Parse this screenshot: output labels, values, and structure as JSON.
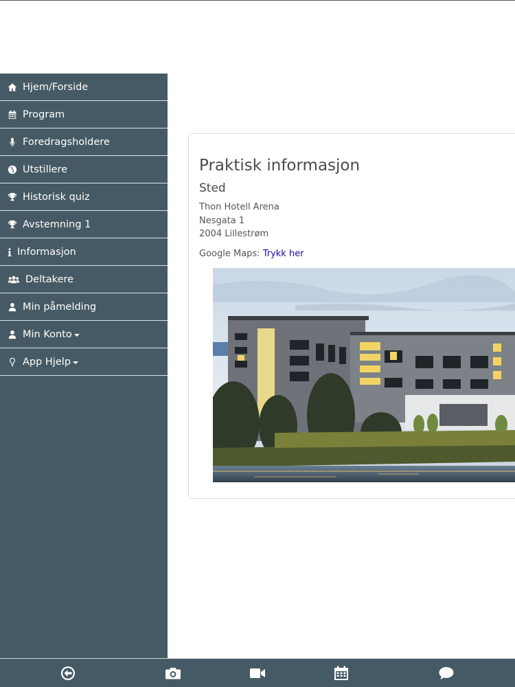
{
  "sidebar": {
    "items": [
      {
        "label": "Hjem/Forside",
        "icon": "home-icon"
      },
      {
        "label": "Program",
        "icon": "calendar-icon"
      },
      {
        "label": "Foredragsholdere",
        "icon": "microphone-icon"
      },
      {
        "label": "Utstillere",
        "icon": "globe-icon"
      },
      {
        "label": "Historisk quiz",
        "icon": "trophy-icon"
      },
      {
        "label": "Avstemning 1",
        "icon": "trophy-icon"
      },
      {
        "label": "Informasjon",
        "icon": "info-icon"
      },
      {
        "label": "Deltakere",
        "icon": "users-icon"
      },
      {
        "label": "Min påmelding",
        "icon": "user-icon"
      },
      {
        "label": "Min Konto",
        "icon": "user-icon",
        "dropdown": true
      },
      {
        "label": "App Hjelp",
        "icon": "lightbulb-icon",
        "dropdown": true
      }
    ]
  },
  "main": {
    "title": "Praktisk informasjon",
    "subtitle": "Sted",
    "address": [
      "Thon Hotell Arena",
      "Nesgata 1",
      "2004 Lillestrøm"
    ],
    "maps_prefix": "Google Maps:",
    "maps_link": "Trykk her",
    "image_icon": "hotel-photo"
  },
  "toolbar": {
    "icons": [
      "back-arrow-icon",
      "camera-icon",
      "video-icon",
      "calendar-icon",
      "chat-icon"
    ]
  },
  "colors": {
    "sidebar_bg": "#455a64",
    "link": "#1a0dab",
    "text": "#4a4a4a"
  }
}
